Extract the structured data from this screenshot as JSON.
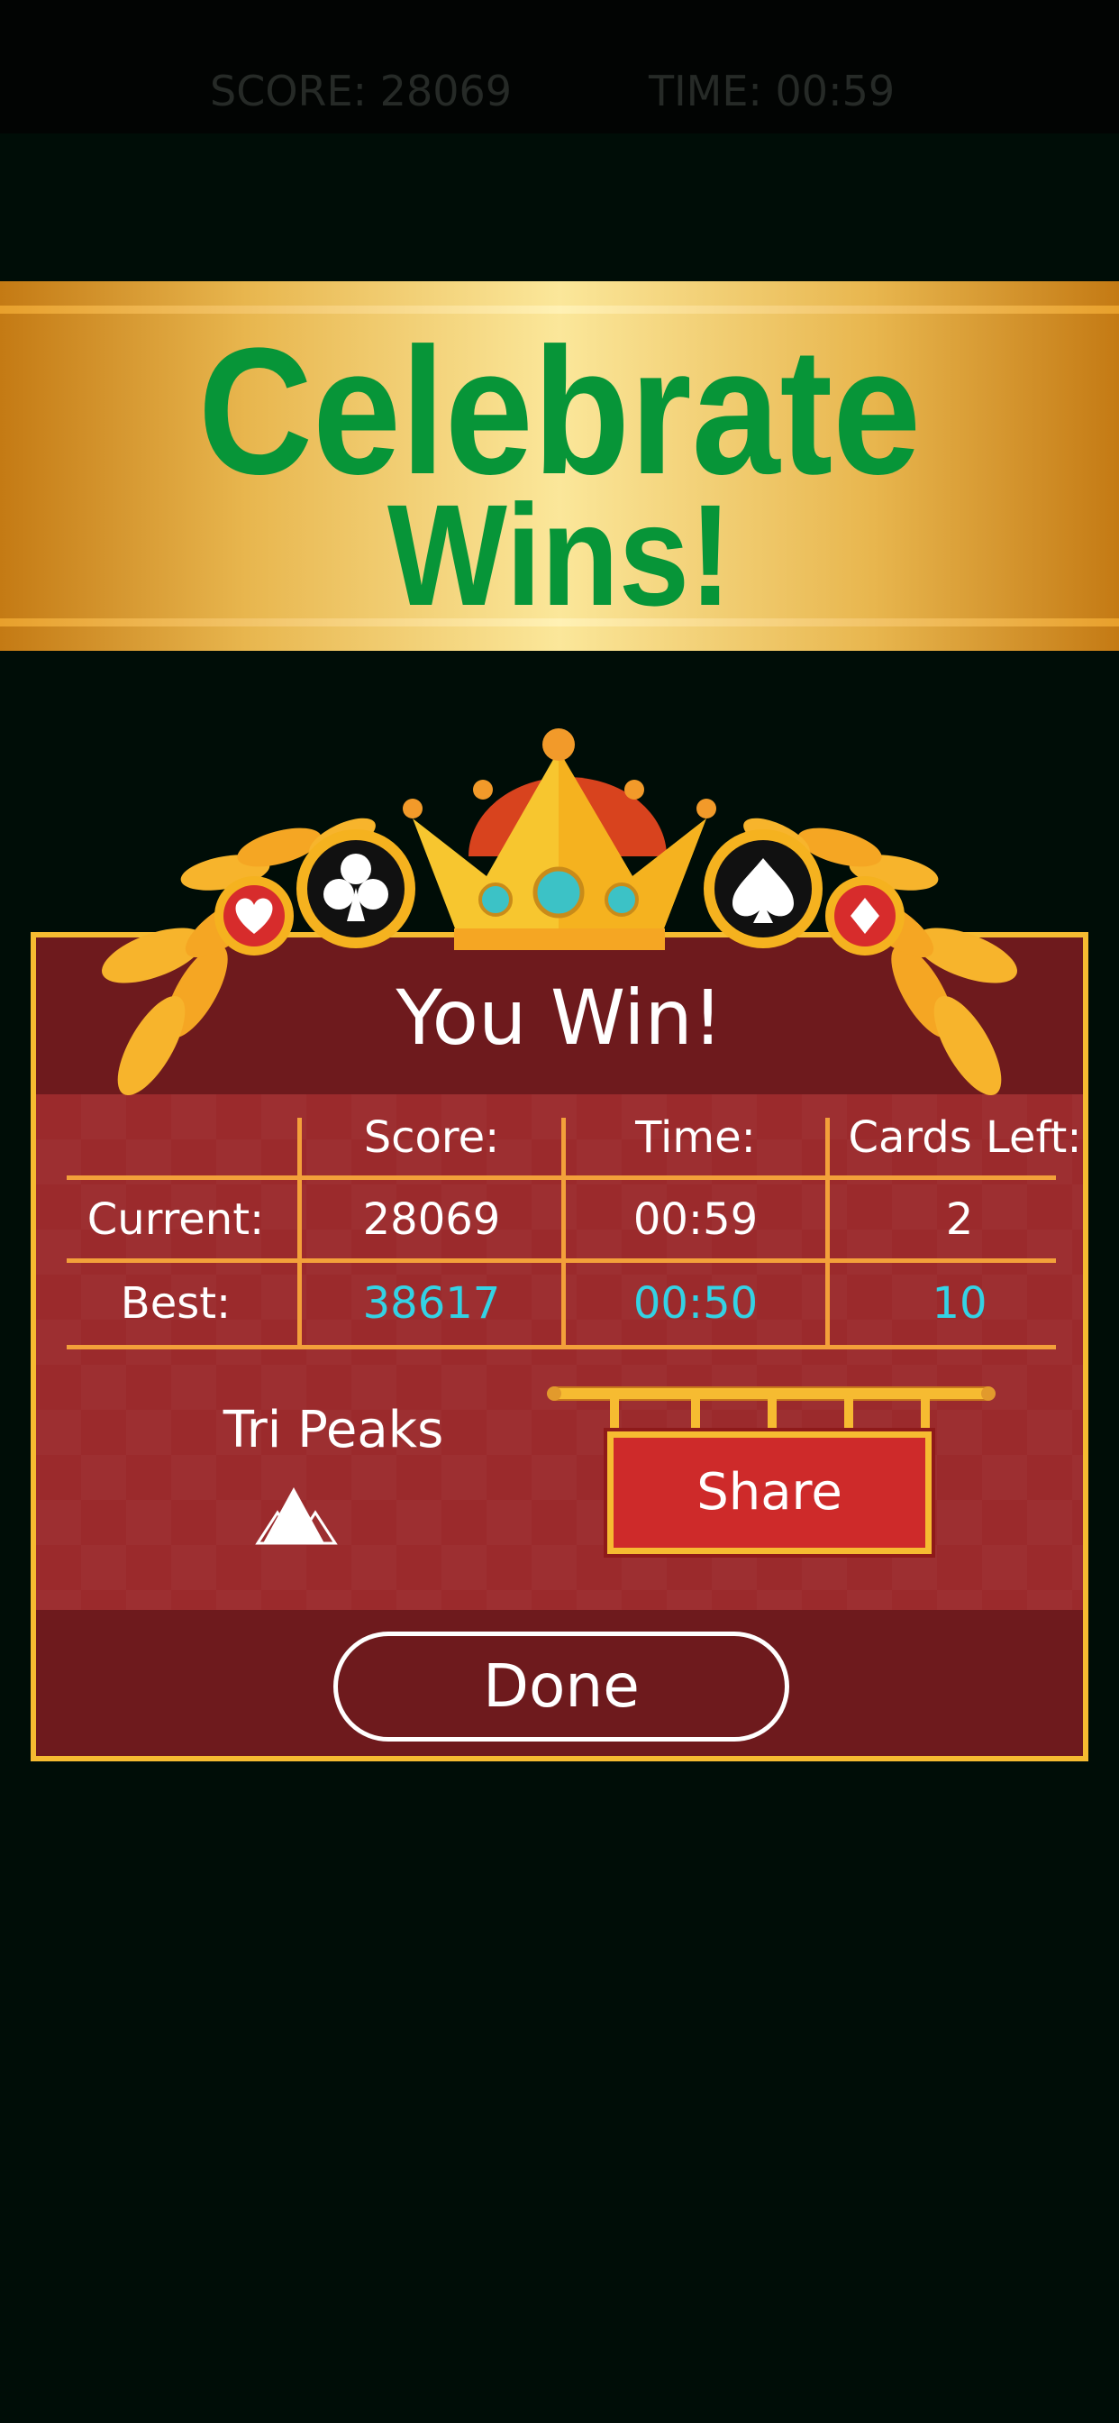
{
  "top_bar": {
    "score_text": "SCORE: 28069",
    "time_text": "TIME: 00:59"
  },
  "banner": {
    "line1": "Celebrate",
    "line2": "Wins!"
  },
  "dialog": {
    "title": "You Win!",
    "columns": [
      "Score:",
      "Time:",
      "Cards Left:"
    ],
    "rows": [
      {
        "label": "Current:",
        "score": "28069",
        "time": "00:59",
        "cards_left": "2"
      },
      {
        "label": "Best:",
        "score": "38617",
        "time": "00:50",
        "cards_left": "10"
      }
    ],
    "game_name": "Tri Peaks",
    "share_label": "Share",
    "done_label": "Done"
  },
  "colors": {
    "background": "#000d07",
    "banner_text": "#079538",
    "panel": "#6e1a1d",
    "panel_border": "#f6bb31",
    "best_values": "#34d2e4",
    "share_button": "#ce2a2a"
  },
  "icons": [
    "crown-icon",
    "club-icon",
    "spade-icon",
    "heart-icon",
    "diamond-icon",
    "laurel-leaves",
    "tri-peaks-icon"
  ]
}
